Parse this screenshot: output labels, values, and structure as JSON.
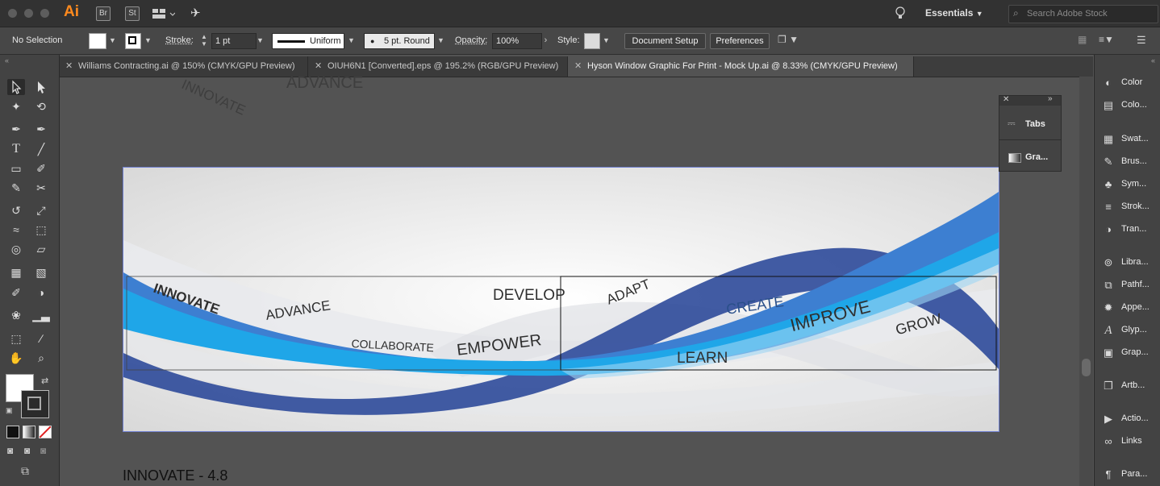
{
  "app": {
    "logo": "Ai",
    "bridge": "Br",
    "stock": "St",
    "workspace": "Essentials",
    "search_placeholder": "Search Adobe Stock"
  },
  "control_bar": {
    "selection": "No Selection",
    "stroke_label": "Stroke:",
    "stroke_value": "1 pt",
    "profile": "Uniform",
    "brush": "5 pt. Round",
    "opacity_label": "Opacity:",
    "opacity_value": "100%",
    "style_label": "Style:",
    "document_setup": "Document Setup",
    "preferences": "Preferences"
  },
  "tabs": [
    {
      "label": "Williams Contracting.ai @ 150% (CMYK/GPU Preview)"
    },
    {
      "label": "OIUH6N1 [Converted].eps @ 195.2% (RGB/GPU Preview)"
    },
    {
      "label": "Hyson Window Graphic For Print - Mock Up.ai @ 8.33% (CMYK/GPU Preview)"
    }
  ],
  "float_panel": {
    "tabs": "Tabs",
    "gradient": "Gra..."
  },
  "right_panel": [
    {
      "icon": "color-icon",
      "label": "Color"
    },
    {
      "icon": "color-guide-icon",
      "label": "Colo..."
    },
    {
      "icon": "swatches-icon",
      "label": "Swat..."
    },
    {
      "icon": "brushes-icon",
      "label": "Brus..."
    },
    {
      "icon": "symbols-icon",
      "label": "Sym..."
    },
    {
      "icon": "stroke-icon",
      "label": "Strok..."
    },
    {
      "icon": "transparency-icon",
      "label": "Tran..."
    },
    {
      "icon": "libraries-icon",
      "label": "Libra..."
    },
    {
      "icon": "pathfinder-icon",
      "label": "Pathf..."
    },
    {
      "icon": "appearance-icon",
      "label": "Appe..."
    },
    {
      "icon": "glyphs-icon",
      "label": "Glyp..."
    },
    {
      "icon": "graphic-styles-icon",
      "label": "Grap..."
    },
    {
      "icon": "artboards-icon",
      "label": "Artb..."
    },
    {
      "icon": "actions-icon",
      "label": "Actio..."
    },
    {
      "icon": "links-icon",
      "label": "Links"
    },
    {
      "icon": "paragraph-icon",
      "label": "Para..."
    }
  ],
  "canvas": {
    "top_words": [
      "INNOVATE",
      "ADVANCE"
    ],
    "artboard_words": [
      "INNOVATE",
      "ADVANCE",
      "COLLABORATE",
      "EMPOWER",
      "DEVELOP",
      "ADAPT",
      "CREATE",
      "IMPROVE",
      "GROW",
      "LEARN"
    ],
    "caption": "INNOVATE - 4.8"
  },
  "colors": {
    "wave_dark": "#2e4a9a",
    "wave_mid": "#3d7fd1",
    "wave_light": "#1fa6e8",
    "wave_grey": "#e4e6ea"
  }
}
